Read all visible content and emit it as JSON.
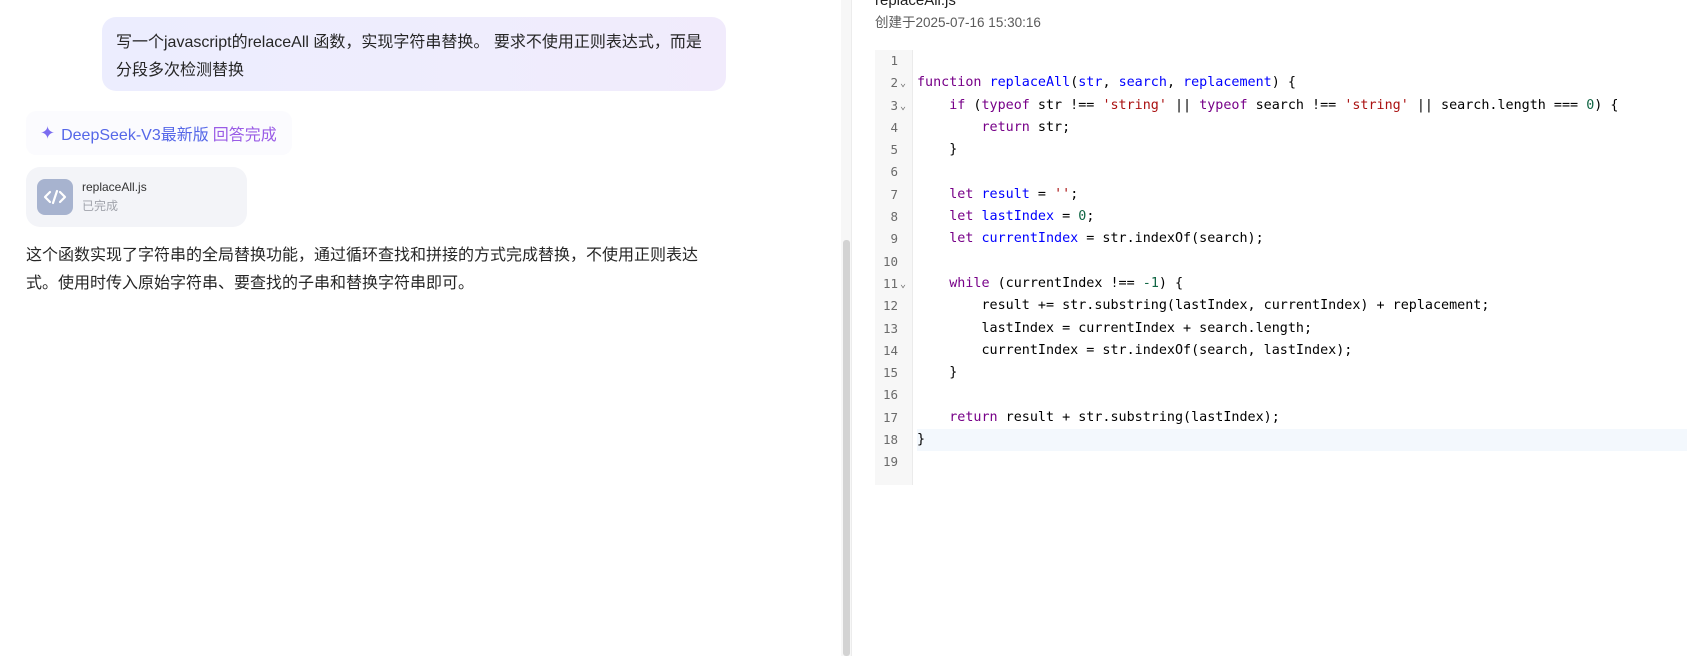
{
  "chat": {
    "user_message": "写一个javascript的relaceAll 函数，实现字符串替换。 要求不使用正则表达式，而是分段多次检测替换",
    "model_name": "DeepSeek-V3最新版",
    "model_status": "回答完成",
    "file_card": {
      "name": "replaceAll.js",
      "status": "已完成",
      "icon": "code-icon"
    },
    "answer": "这个函数实现了字符串的全局替换功能，通过循环查找和拼接的方式完成替换，不使用正则表达式。使用时传入原始字符串、要查找的子串和替换字符串即可。"
  },
  "code_panel": {
    "title": "replaceAll.js",
    "created": "创建于2025-07-16 15:30:16",
    "active_line": 18,
    "folded_markers": [
      2,
      3,
      11
    ],
    "lines": [
      "",
      "function replaceAll(str, search, replacement) {",
      "    if (typeof str !== 'string' || typeof search !== 'string' || search.length === 0) {",
      "        return str;",
      "    }",
      "",
      "    let result = '';",
      "    let lastIndex = 0;",
      "    let currentIndex = str.indexOf(search);",
      "",
      "    while (currentIndex !== -1) {",
      "        result += str.substring(lastIndex, currentIndex) + replacement;",
      "        lastIndex = currentIndex + search.length;",
      "        currentIndex = str.indexOf(search, lastIndex);",
      "    }",
      "",
      "    return result + str.substring(lastIndex);",
      "}",
      ""
    ]
  },
  "colors": {
    "accent": "#5567e8",
    "status": "#9a5ce6",
    "bubble": "#ecedfe"
  }
}
